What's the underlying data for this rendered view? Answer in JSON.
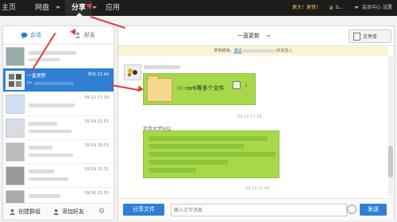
{
  "topnav": {
    "items": [
      {
        "label": "主页"
      },
      {
        "label": "网盘"
      },
      {
        "label": "分享"
      },
      {
        "label": "应用"
      }
    ],
    "promo_text": "更大！更快！",
    "username": "b...",
    "member_label": "会员中心",
    "settings_label": "设置"
  },
  "sidebar": {
    "tabs": [
      {
        "label": "会话"
      },
      {
        "label": "好友"
      }
    ],
    "items": [
      {
        "name": "",
        "date": "",
        "sub": ""
      },
      {
        "name": "一直更新",
        "date": "昨天 21:40",
        "sub": "yu"
      },
      {
        "name": "",
        "date": "09-12 17:18",
        "sub": ""
      },
      {
        "name": "",
        "date": "09-09 21:51",
        "sub": ""
      },
      {
        "name": "",
        "date": "09-09 18:53",
        "sub": ""
      },
      {
        "name": "",
        "date": "09-09 15:31",
        "sub": ""
      },
      {
        "name": "",
        "date": "09-06 21:55",
        "sub": ""
      },
      {
        "name": "",
        "date": "08-22 18:34",
        "sub": ""
      }
    ],
    "create_group_label": "创建群组",
    "add_friend_label": "添加好友"
  },
  "chat": {
    "title": "一直更新",
    "file_library_label": "文件库",
    "notice_pre": "复制链接，",
    "notice_link": "邀请",
    "notice_post": "好友加入",
    "message1_text": "rar6等多个文件",
    "timestamp1": "09-12 17:18",
    "sender2": "北京大学502",
    "timestamp2": "09-12 21:40",
    "share_file_label": "分享文件",
    "input_placeholder": "输入文字消息",
    "send_label": "发送"
  }
}
